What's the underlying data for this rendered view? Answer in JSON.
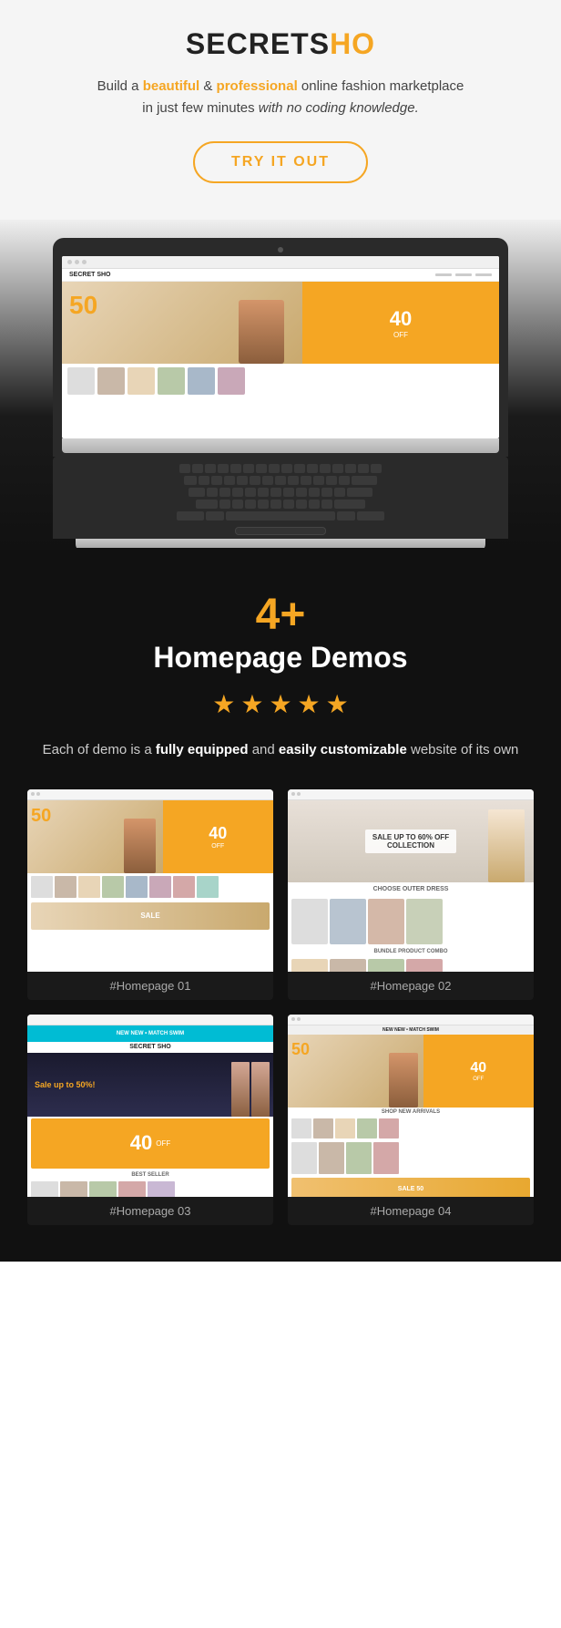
{
  "header": {
    "logo_text": "SECRETSHO",
    "logo_black": "SECRETS",
    "logo_orange": "HO",
    "tagline_line1": "Build a ",
    "beautiful": "beautiful",
    "amp": " & ",
    "professional": "professional",
    "tagline_mid": " online fashion marketplace",
    "tagline_line2": "in just few minutes ",
    "italic_text": "with no coding knowledge.",
    "cta_button": "TRY IT OUT"
  },
  "demos_section": {
    "count": "4+",
    "title": "Homepage Demos",
    "stars": [
      "★",
      "★",
      "★",
      "★",
      "★"
    ],
    "description_line1": "Each of demo is a ",
    "fully_equipped": "fully equipped",
    "description_line2": " and ",
    "easily_customizable": "easily customizable",
    "description_line3": " website of its own"
  },
  "demos": [
    {
      "id": "demo-1",
      "label": "#Homepage 01"
    },
    {
      "id": "demo-2",
      "label": "#Homepage 02"
    },
    {
      "id": "demo-3",
      "label": "#Homepage 03"
    },
    {
      "id": "demo-4",
      "label": "#Homepage 04"
    }
  ]
}
